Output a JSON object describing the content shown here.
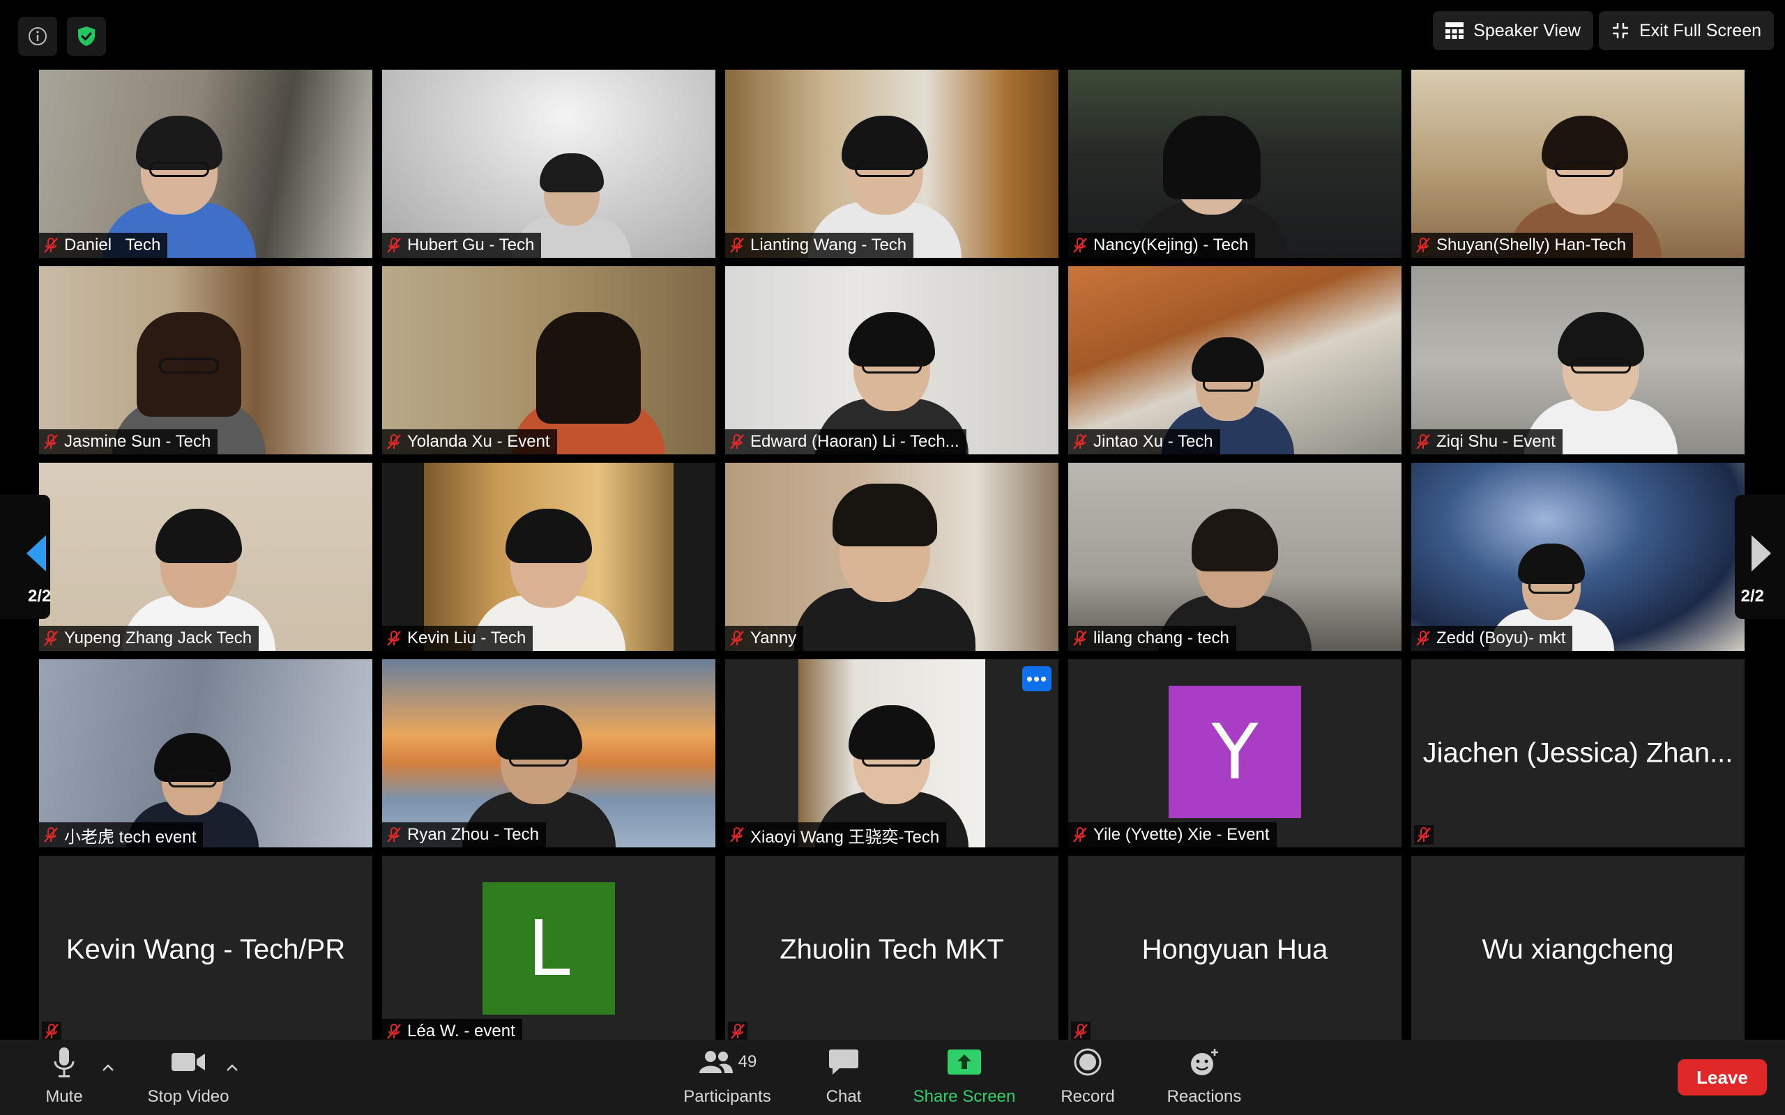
{
  "top_bar": {
    "speaker_view_label": "Speaker View",
    "exit_full_screen_label": "Exit Full Screen"
  },
  "pagination": {
    "left_label": "2/2",
    "right_label": "2/2"
  },
  "participants": [
    {
      "name": "Daniel   Tech",
      "type": "video",
      "muted": true
    },
    {
      "name": "Hubert Gu - Tech",
      "type": "video",
      "muted": true
    },
    {
      "name": "Lianting Wang - Tech",
      "type": "video",
      "muted": true
    },
    {
      "name": "Nancy(Kejing) - Tech",
      "type": "video",
      "muted": true
    },
    {
      "name": "Shuyan(Shelly) Han-Tech",
      "type": "video",
      "muted": true
    },
    {
      "name": "Jasmine Sun - Tech",
      "type": "video",
      "muted": true
    },
    {
      "name": "Yolanda Xu - Event",
      "type": "video",
      "muted": true
    },
    {
      "name": "Edward (Haoran) Li - Tech...",
      "type": "video",
      "muted": true
    },
    {
      "name": "Jintao Xu - Tech",
      "type": "video",
      "muted": true
    },
    {
      "name": "Ziqi Shu - Event",
      "type": "video",
      "muted": true
    },
    {
      "name": "Yupeng Zhang Jack Tech",
      "type": "video",
      "muted": true
    },
    {
      "name": "Kevin Liu - Tech",
      "type": "video",
      "muted": true
    },
    {
      "name": "Yanny",
      "type": "video",
      "muted": true
    },
    {
      "name": "lilang chang - tech",
      "type": "video",
      "muted": true
    },
    {
      "name": "Zedd (Boyu)- mkt",
      "type": "video",
      "muted": true
    },
    {
      "name": "小老虎 tech event",
      "type": "video",
      "muted": true
    },
    {
      "name": "Ryan Zhou - Tech",
      "type": "video",
      "muted": true
    },
    {
      "name": "Xiaoyi Wang 王骁奕-Tech",
      "type": "video",
      "muted": true,
      "more_label": "•••"
    },
    {
      "name": "Yile (Yvette) Xie - Event",
      "type": "avatar",
      "muted": true,
      "avatar_letter": "Y",
      "avatar_color": "#a93ec4"
    },
    {
      "center_name": "Jiachen (Jessica) Zhan...",
      "type": "name-only",
      "muted": true
    },
    {
      "center_name": "Kevin Wang - Tech/PR",
      "type": "name-only",
      "muted": true
    },
    {
      "name": "Léa W. - event",
      "type": "avatar",
      "muted": true,
      "avatar_letter": "L",
      "avatar_color": "#2e7d1e"
    },
    {
      "center_name": "Zhuolin Tech MKT",
      "type": "name-only",
      "muted": true
    },
    {
      "center_name": "Hongyuan Hua",
      "type": "name-only",
      "muted": true
    },
    {
      "center_name": "Wu xiangcheng",
      "type": "name-only",
      "muted": true
    }
  ],
  "toolbar": {
    "mute_label": "Mute",
    "stop_video_label": "Stop Video",
    "participants_label": "Participants",
    "participants_count": "49",
    "chat_label": "Chat",
    "share_screen_label": "Share Screen",
    "record_label": "Record",
    "reactions_label": "Reactions",
    "leave_label": "Leave",
    "caret": "^"
  },
  "colors": {
    "share_green": "#2fd06a",
    "leave_red": "#e02828",
    "muted_red": "#e02828",
    "shield_green": "#22c55e",
    "nav_arrow_blue": "#2d9cf0",
    "more_button_blue": "#0e71eb"
  }
}
